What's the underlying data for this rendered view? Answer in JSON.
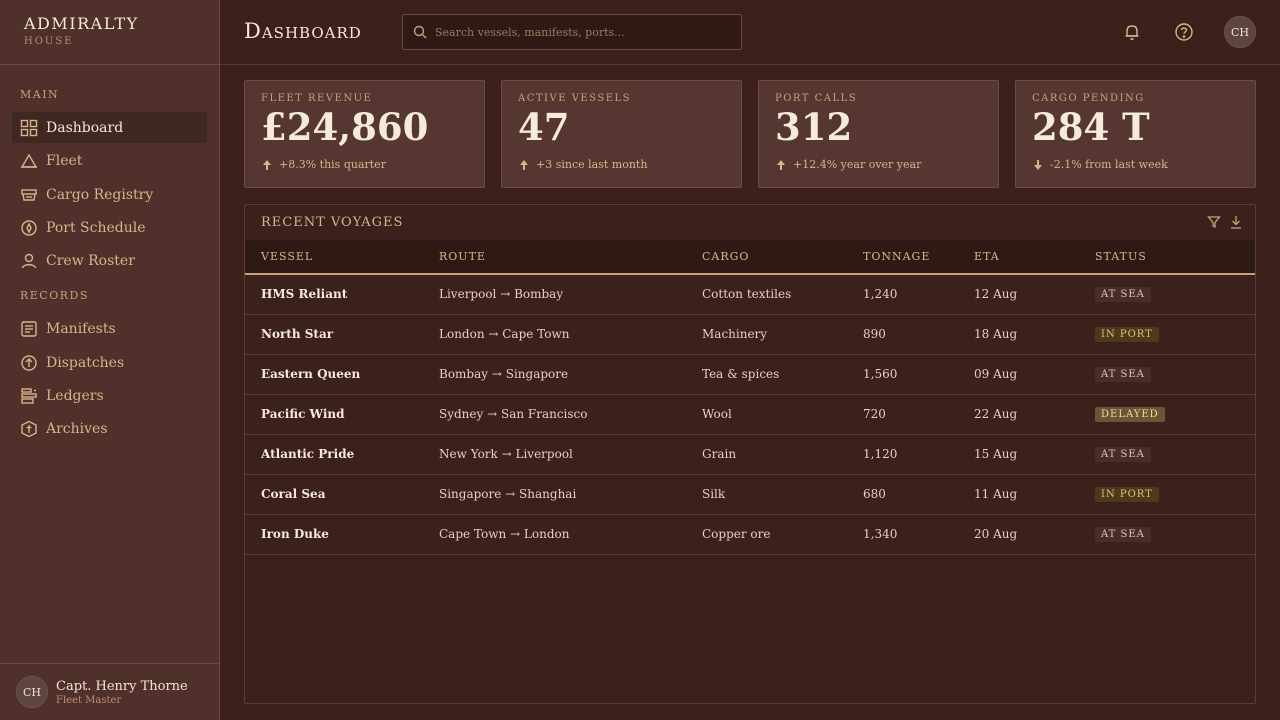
{
  "brand": {
    "title": "ADMIRALTY",
    "subtitle": "HOUSE"
  },
  "sidebar": {
    "sections": [
      "MAIN",
      "RECORDS"
    ],
    "items": [
      {
        "label": "Dashboard",
        "icon": "grid-icon",
        "active": true
      },
      {
        "label": "Fleet",
        "icon": "ship-icon"
      },
      {
        "label": "Cargo Registry",
        "icon": "cargo-icon"
      },
      {
        "label": "Port Schedule",
        "icon": "compass-icon"
      },
      {
        "label": "Crew Roster",
        "icon": "person-icon"
      },
      {
        "label": "Manifests",
        "icon": "document-icon"
      },
      {
        "label": "Dispatches",
        "icon": "dispatch-icon"
      },
      {
        "label": "Ledgers",
        "icon": "ledger-icon"
      },
      {
        "label": "Archives",
        "icon": "archive-icon"
      }
    ]
  },
  "user": {
    "initials": "CH",
    "name": "Capt. Henry Thorne",
    "role": "Fleet Master"
  },
  "header": {
    "title": "Dashboard",
    "search_placeholder": "Search vessels, manifests, ports...",
    "avatar_initials": "CH"
  },
  "kpis": [
    {
      "label": "FLEET REVENUE",
      "value": "£24,860",
      "delta": "+8.3% this quarter",
      "trend": "up"
    },
    {
      "label": "ACTIVE VESSELS",
      "value": "47",
      "delta": "+3 since last month",
      "trend": "up"
    },
    {
      "label": "PORT CALLS",
      "value": "312",
      "delta": "+12.4% year over year",
      "trend": "up"
    },
    {
      "label": "CARGO PENDING",
      "value": "284 T",
      "delta": "-2.1% from last week",
      "trend": "down"
    }
  ],
  "voyages": {
    "title": "RECENT VOYAGES",
    "columns": [
      "VESSEL",
      "ROUTE",
      "CARGO",
      "TONNAGE",
      "ETA",
      "STATUS"
    ],
    "rows": [
      {
        "vessel": "HMS Reliant",
        "route": "Liverpool → Bombay",
        "cargo": "Cotton textiles",
        "tonnage": "1,240",
        "eta": "12 Aug",
        "status": "AT SEA"
      },
      {
        "vessel": "North Star",
        "route": "London → Cape Town",
        "cargo": "Machinery",
        "tonnage": "890",
        "eta": "18 Aug",
        "status": "IN PORT"
      },
      {
        "vessel": "Eastern Queen",
        "route": "Bombay → Singapore",
        "cargo": "Tea & spices",
        "tonnage": "1,560",
        "eta": "09 Aug",
        "status": "AT SEA"
      },
      {
        "vessel": "Pacific Wind",
        "route": "Sydney → San Francisco",
        "cargo": "Wool",
        "tonnage": "720",
        "eta": "22 Aug",
        "status": "DELAYED"
      },
      {
        "vessel": "Atlantic Pride",
        "route": "New York → Liverpool",
        "cargo": "Grain",
        "tonnage": "1,120",
        "eta": "15 Aug",
        "status": "AT SEA"
      },
      {
        "vessel": "Coral Sea",
        "route": "Singapore → Shanghai",
        "cargo": "Silk",
        "tonnage": "680",
        "eta": "11 Aug",
        "status": "IN PORT"
      },
      {
        "vessel": "Iron Duke",
        "route": "Cape Town → London",
        "cargo": "Copper ore",
        "tonnage": "1,340",
        "eta": "20 Aug",
        "status": "AT SEA"
      }
    ]
  },
  "colors": {
    "background": "#3b201b",
    "sidebar": "#4f302a",
    "accent": "#c9a07a",
    "card": "#553630"
  }
}
